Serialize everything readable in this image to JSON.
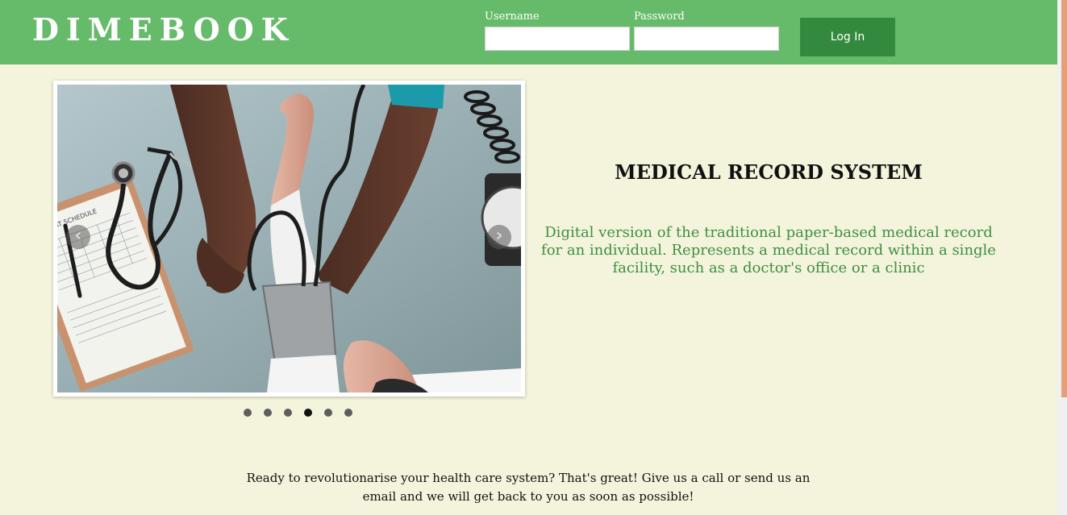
{
  "header": {
    "logo": "DIMEBOOK",
    "username_label": "Username",
    "username_value": "",
    "password_label": "Password",
    "password_value": "",
    "login_label": "Log In"
  },
  "carousel": {
    "prev_arrow": "‹",
    "next_arrow": "›",
    "slide_count": 6,
    "active_index": 3,
    "image_labels": {
      "clipboard_text": "REPORT SCHEDULE"
    }
  },
  "hero": {
    "title": "MEDICAL RECORD SYSTEM",
    "description": "Digital version of the traditional paper-based medical record for an individual. Represents a medical record within a single facility, such as a doctor's office or a clinic"
  },
  "cta": {
    "text": "Ready to revolutionarise your health care system? That's great! Give us a call or send us an email and we will get back to you as soon as possible!"
  },
  "colors": {
    "header_bg": "#66bb6a",
    "login_button_bg": "#338a3e",
    "page_bg": "#f4f4dc",
    "hero_desc": "#3d8f41"
  }
}
